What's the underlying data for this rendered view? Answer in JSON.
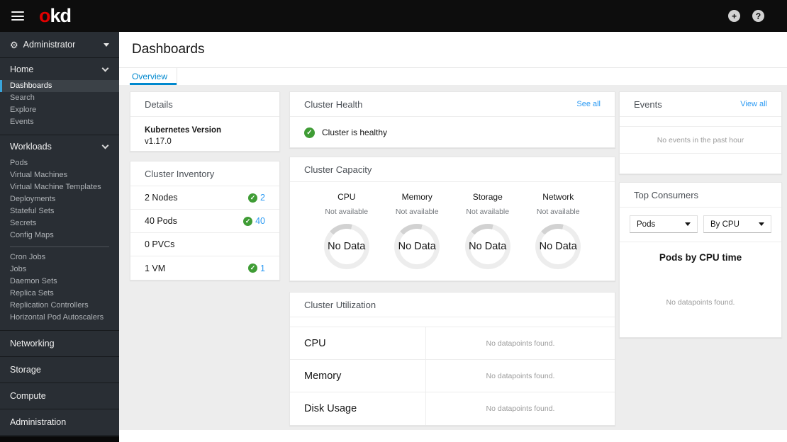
{
  "masthead": {
    "brand_primary": "o",
    "brand_secondary": "kd",
    "plus_glyph": "+",
    "help_glyph": "?"
  },
  "sidebar": {
    "perspective": {
      "label": "Administrator",
      "icon": "cogs-icon"
    },
    "sections": [
      {
        "label": "Home",
        "expanded": true,
        "items": [
          {
            "label": "Dashboards",
            "active": true
          },
          {
            "label": "Search"
          },
          {
            "label": "Explore"
          },
          {
            "label": "Events"
          }
        ]
      },
      {
        "label": "Workloads",
        "expanded": true,
        "items_a": [
          "Pods",
          "Virtual Machines",
          "Virtual Machine Templates",
          "Deployments",
          "Stateful Sets",
          "Secrets",
          "Config Maps"
        ],
        "items_b": [
          "Cron Jobs",
          "Jobs",
          "Daemon Sets",
          "Replica Sets",
          "Replication Controllers",
          "Horizontal Pod Autoscalers"
        ]
      },
      {
        "label": "Networking"
      },
      {
        "label": "Storage"
      },
      {
        "label": "Compute"
      },
      {
        "label": "Administration"
      }
    ]
  },
  "page": {
    "title": "Dashboards",
    "tabs": [
      {
        "label": "Overview",
        "active": true
      }
    ]
  },
  "cards": {
    "details": {
      "title": "Details",
      "fields": [
        {
          "label": "Kubernetes Version",
          "value": "v1.17.0"
        }
      ]
    },
    "inventory": {
      "title": "Cluster Inventory",
      "rows": [
        {
          "label": "2 Nodes",
          "status": "ok",
          "count": "2"
        },
        {
          "label": "40 Pods",
          "status": "ok",
          "count": "40"
        },
        {
          "label": "0 PVCs",
          "status": "none",
          "count": ""
        },
        {
          "label": "1 VM",
          "status": "ok",
          "count": "1"
        }
      ]
    },
    "health": {
      "title": "Cluster Health",
      "link": "See all",
      "status": "ok",
      "message": "Cluster is healthy"
    },
    "capacity": {
      "title": "Cluster Capacity",
      "gauges": [
        {
          "label": "CPU",
          "availability": "Not available",
          "value": "No Data"
        },
        {
          "label": "Memory",
          "availability": "Not available",
          "value": "No Data"
        },
        {
          "label": "Storage",
          "availability": "Not available",
          "value": "No Data"
        },
        {
          "label": "Network",
          "availability": "Not available",
          "value": "No Data"
        }
      ]
    },
    "utilization": {
      "title": "Cluster Utilization",
      "rows": [
        {
          "label": "CPU",
          "message": "No datapoints found."
        },
        {
          "label": "Memory",
          "message": "No datapoints found."
        },
        {
          "label": "Disk Usage",
          "message": "No datapoints found."
        }
      ]
    },
    "events": {
      "title": "Events",
      "link": "View all",
      "empty_message": "No events in the past hour"
    },
    "consumers": {
      "title": "Top Consumers",
      "filters": [
        {
          "value": "Pods"
        },
        {
          "value": "By CPU"
        }
      ],
      "chart_title": "Pods by CPU time",
      "empty_message": "No datapoints found."
    }
  },
  "colors": {
    "accent_blue": "#0088ce",
    "link_blue": "#2b9af3",
    "success_green": "#3f9c35",
    "brand_red": "#e00000",
    "masthead_bg": "#0d0d0d",
    "sidebar_bg": "#292e34",
    "content_bg": "#ededed"
  },
  "status_glyph": "✓"
}
